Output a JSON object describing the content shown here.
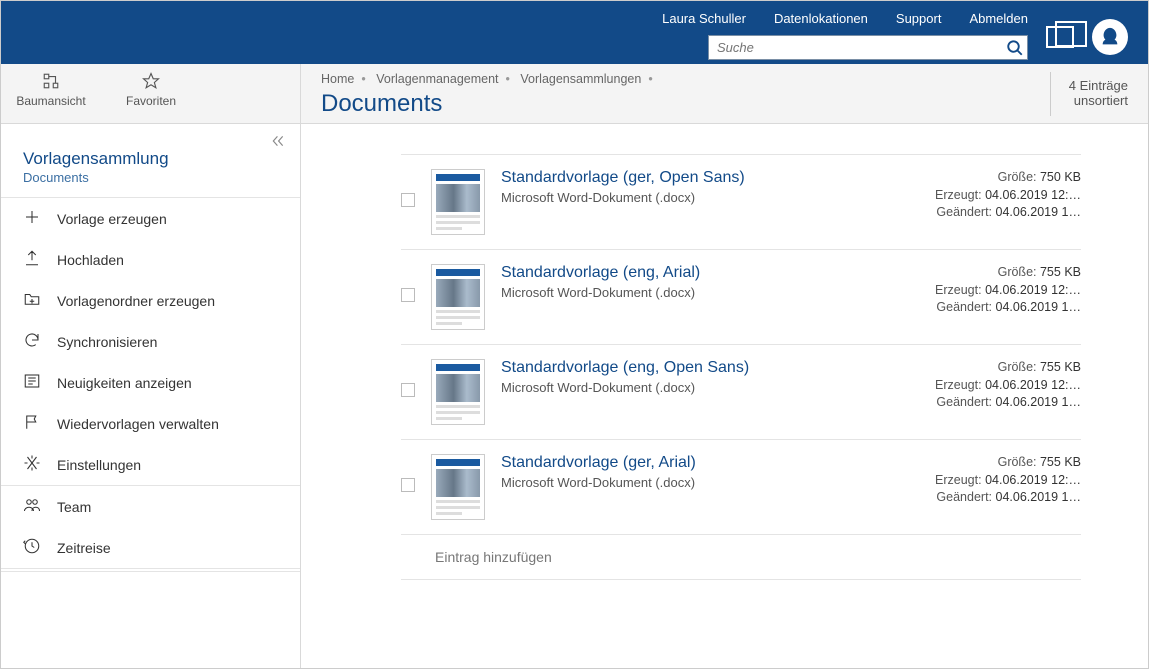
{
  "top": {
    "links": [
      "Laura Schuller",
      "Datenlokationen",
      "Support",
      "Abmelden"
    ],
    "search_placeholder": "Suche"
  },
  "tabs": {
    "tree": "Baumansicht",
    "fav": "Favoriten"
  },
  "breadcrumb": [
    "Home",
    "Vorlagenmanagement",
    "Vorlagensammlungen"
  ],
  "page_title": "Documents",
  "count": {
    "line1": "4 Einträge",
    "line2": "unsortiert"
  },
  "side": {
    "heading": "Vorlagensammlung",
    "subheading": "Documents",
    "items1": [
      {
        "icon": "plus",
        "label": "Vorlage erzeugen"
      },
      {
        "icon": "upload",
        "label": "Hochladen"
      },
      {
        "icon": "folder-plus",
        "label": "Vorlagenordner erzeugen"
      },
      {
        "icon": "sync",
        "label": "Synchronisieren"
      },
      {
        "icon": "news",
        "label": "Neuigkeiten anzeigen"
      },
      {
        "icon": "flag",
        "label": "Wiedervorlagen verwalten"
      },
      {
        "icon": "settings",
        "label": "Einstellungen"
      }
    ],
    "items2": [
      {
        "icon": "team",
        "label": "Team"
      },
      {
        "icon": "clock",
        "label": "Zeitreise"
      }
    ]
  },
  "docs": [
    {
      "title": "Standardvorlage (ger, Open Sans)",
      "subtitle": "Microsoft Word-Dokument (.docx)",
      "size": "750 KB",
      "created": "04.06.2019 12:…",
      "modified": "04.06.2019 1…"
    },
    {
      "title": "Standardvorlage (eng, Arial)",
      "subtitle": "Microsoft Word-Dokument (.docx)",
      "size": "755 KB",
      "created": "04.06.2019 12:…",
      "modified": "04.06.2019 1…"
    },
    {
      "title": "Standardvorlage (eng, Open Sans)",
      "subtitle": "Microsoft Word-Dokument (.docx)",
      "size": "755 KB",
      "created": "04.06.2019 12:…",
      "modified": "04.06.2019 1…"
    },
    {
      "title": "Standardvorlage (ger, Arial)",
      "subtitle": "Microsoft Word-Dokument (.docx)",
      "size": "755 KB",
      "created": "04.06.2019 12:…",
      "modified": "04.06.2019 1…"
    }
  ],
  "labels": {
    "size": "Größe:",
    "created": "Erzeugt:",
    "modified": "Geändert:",
    "add": "Eintrag hinzufügen"
  }
}
